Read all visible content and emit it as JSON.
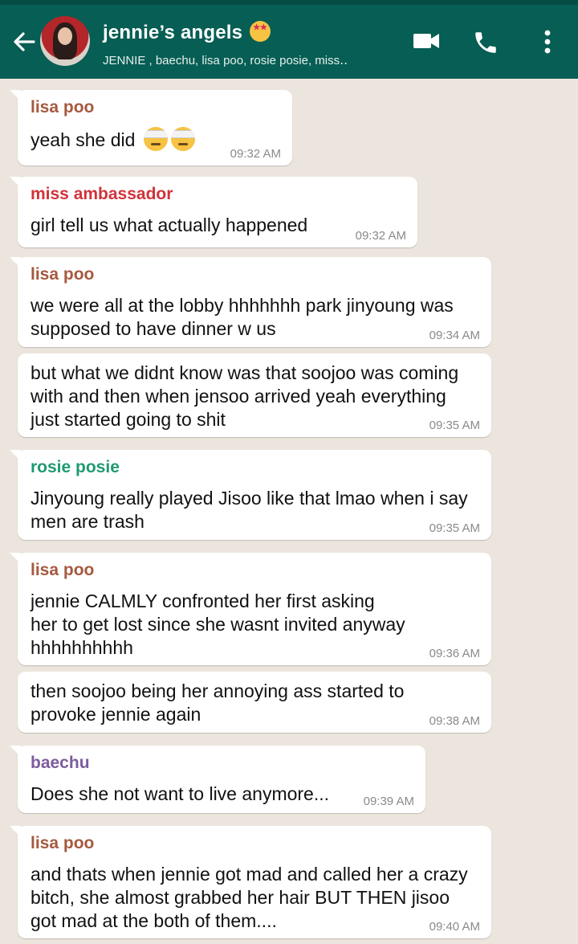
{
  "header": {
    "title": "jennie’s angels",
    "title_emoji": "star-struck-emoji",
    "members": "JENNIE , baechu, lisa poo, rosie posie, miss‥",
    "colors": {
      "bar": "#075e54",
      "status": "#054d44"
    },
    "icons": [
      "back-arrow-icon",
      "avatar",
      "video-call-icon",
      "voice-call-icon",
      "more-options-icon"
    ]
  },
  "colors": {
    "lisa": "#a5593f",
    "miss": "#d1323a",
    "rosie": "#1f9a72",
    "baechu": "#7c5c9e",
    "background": "#ece5dd"
  },
  "messages": [
    {
      "sender": "lisa poo",
      "text": "yeah she did",
      "emoji": "face-with-head-bandage x2",
      "time": "09:32 AM"
    },
    {
      "sender": "miss ambassador",
      "text": "girl tell us what actually happened",
      "time": "09:32 AM"
    },
    {
      "sender": "lisa poo",
      "text": "we were all at the lobby hhhhhhh park jinyoung was\nsupposed to have dinner w us",
      "time": "09:34 AM"
    },
    {
      "sender": "",
      "text": "but what we didnt know was that soojoo was coming\nwith and then when jensoo arrived yeah everything\njust started going to shit",
      "time": "09:35 AM"
    },
    {
      "sender": "rosie posie",
      "text": "Jinyoung really played Jisoo like that lmao when i say\nmen are trash",
      "time": "09:35 AM"
    },
    {
      "sender": "lisa poo",
      "text": "jennie CALMLY confronted her first asking\nher to get lost since she wasnt invited anyway\nhhhhhhhhhh",
      "time": "09:36 AM"
    },
    {
      "sender": "",
      "text": "then soojoo being her annoying ass started to\nprovoke jennie again",
      "time": "09:38 AM"
    },
    {
      "sender": "baechu",
      "text": "Does she not want to live anymore...",
      "time": "09:39 AM"
    },
    {
      "sender": "lisa poo",
      "text": "and thats when jennie got mad and called her a crazy\nbitch, she almost grabbed her hair BUT THEN jisoo\ngot mad at the both of them....",
      "time": "09:40 AM"
    }
  ]
}
